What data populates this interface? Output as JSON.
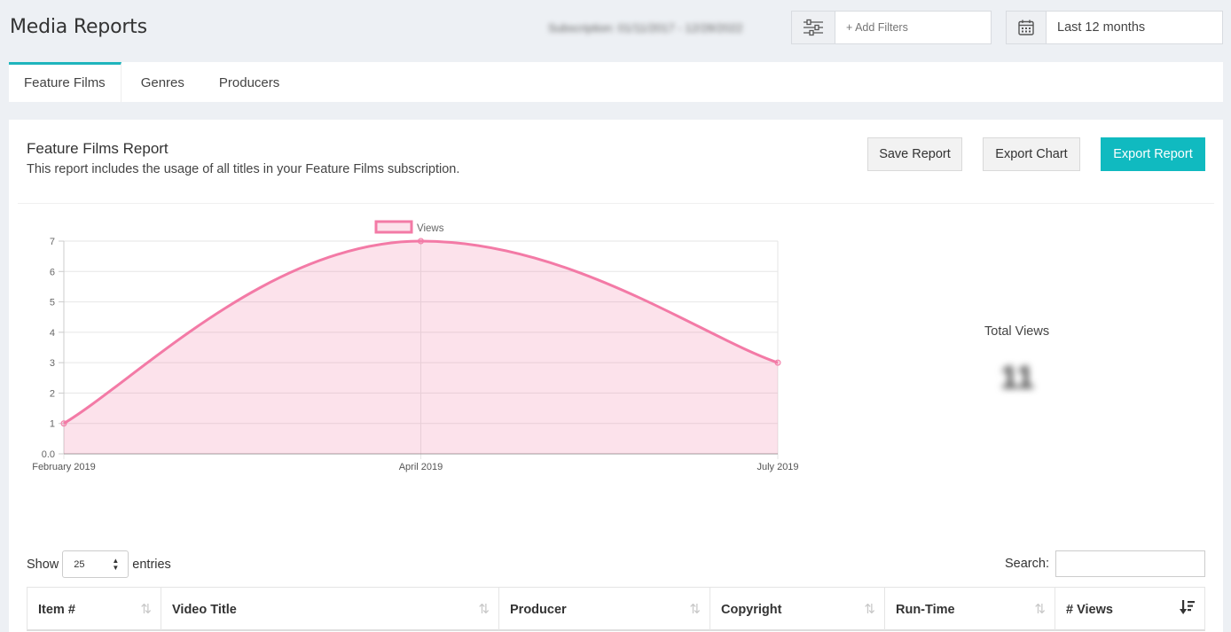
{
  "header": {
    "title": "Media Reports",
    "subscription": "Subscription: 01/11/2017 - 12/28/2022",
    "filters_placeholder": "+ Add Filters",
    "date_range": "Last 12 months"
  },
  "tabs": [
    {
      "label": "Feature Films",
      "active": true
    },
    {
      "label": "Genres",
      "active": false
    },
    {
      "label": "Producers",
      "active": false
    }
  ],
  "report": {
    "title": "Feature Films Report",
    "description": "This report includes the usage of all titles in your Feature Films subscription.",
    "buttons": {
      "save": "Save Report",
      "export_chart": "Export Chart",
      "export_report": "Export Report"
    },
    "accent_color": "#10bac0"
  },
  "chart_data": {
    "type": "area",
    "categories": [
      "February 2019",
      "April 2019",
      "July 2019"
    ],
    "series": [
      {
        "name": "Views",
        "values": [
          1,
          7,
          3
        ],
        "color": "#f37aa6"
      }
    ],
    "ylim": [
      0,
      7
    ],
    "yticks": [
      "0.0",
      "1",
      "2",
      "3",
      "4",
      "5",
      "6",
      "7"
    ],
    "legend": "top",
    "grid": true
  },
  "summary": {
    "label": "Total Views",
    "value": "11"
  },
  "table": {
    "show_label": "Show",
    "entries_value": "25",
    "entries_label": "entries",
    "search_label": "Search:",
    "columns": [
      "Item #",
      "Video Title",
      "Producer",
      "Copyright",
      "Run-Time",
      "# Views"
    ]
  }
}
